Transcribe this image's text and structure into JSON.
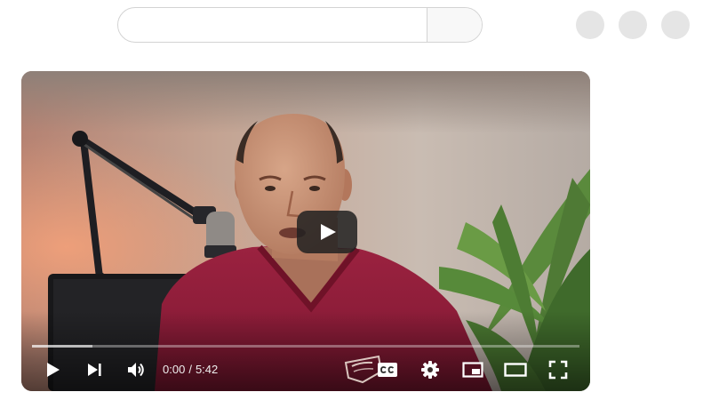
{
  "header": {
    "search": {
      "value": "",
      "placeholder": ""
    }
  },
  "player": {
    "overlay": {
      "play_icon": "play-icon"
    },
    "progress": {
      "loaded_fraction": 0.11,
      "played_fraction": 0.0
    },
    "controls": {
      "current_time": "0:00",
      "separator": "/",
      "duration": "5:42",
      "icons": [
        "play-icon",
        "next-icon",
        "volume-icon",
        "captions-icon",
        "settings-gear-icon",
        "miniplayer-icon",
        "theater-mode-icon",
        "fullscreen-icon"
      ]
    },
    "colors": {
      "overlay_button": "#212121",
      "controls": "#ffffff",
      "shirt": "#8b1a34"
    }
  }
}
